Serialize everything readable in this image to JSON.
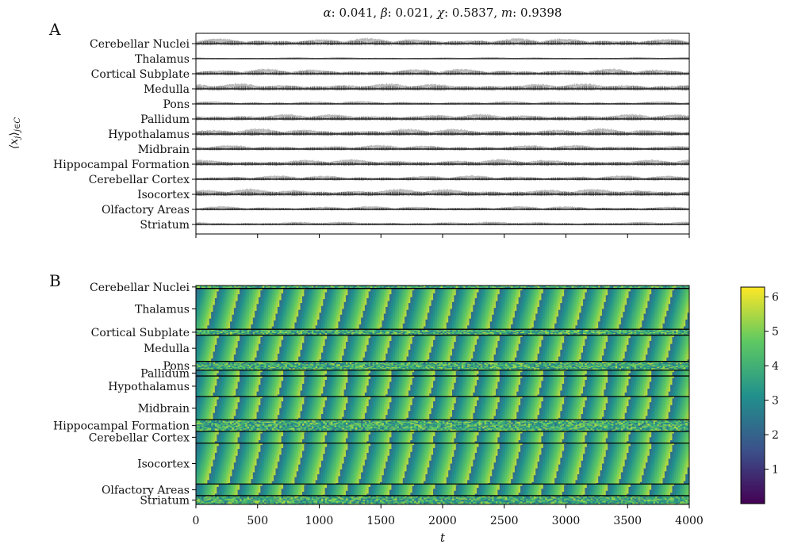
{
  "figure": {
    "title": "α: 0.041, β: 0.021, χ: 0.5837, m: 0.9398",
    "title_parts": [
      {
        "text": "α",
        "italic": true
      },
      {
        "text": ": 0.041, ",
        "italic": false
      },
      {
        "text": "β",
        "italic": true
      },
      {
        "text": ": 0.021, ",
        "italic": false
      },
      {
        "text": "χ",
        "italic": true
      },
      {
        "text": ": 0.5837, ",
        "italic": false
      },
      {
        "text": "m",
        "italic": true
      },
      {
        "text": ": 0.9398",
        "italic": false
      }
    ]
  },
  "chart_data": [
    {
      "type": "line",
      "panel_label": "A",
      "ylabel": "⟨x_j⟩_{j∈C}",
      "ylabel_parts": {
        "base": "⟨x",
        "sub1": "j",
        "close": "⟩",
        "sub2": "j∈C"
      },
      "xlim": [
        0,
        4000
      ],
      "xticks": [
        0,
        500,
        1000,
        1500,
        2000,
        2500,
        3000,
        3500,
        4000
      ],
      "xticklabels_shown": false,
      "grid": false,
      "series_color": "#222222",
      "series_alt_color": "#a8a8a8",
      "regions": [
        "Cerebellar Nuclei",
        "Thalamus",
        "Cortical Subplate",
        "Medulla",
        "Pons",
        "Pallidum",
        "Hypothalamus",
        "Midbrain",
        "Hippocampal Formation",
        "Cerebellar Cortex",
        "Isocortex",
        "Olfactory Areas",
        "Striatum"
      ],
      "series_amplitude": [
        1.0,
        0.3,
        0.9,
        1.0,
        0.5,
        0.9,
        1.0,
        0.75,
        0.9,
        0.7,
        1.0,
        0.6,
        0.5
      ]
    },
    {
      "type": "heatmap",
      "panel_label": "B",
      "xlabel": "t",
      "xlim": [
        0,
        4000
      ],
      "xticks": [
        0,
        500,
        1000,
        1500,
        2000,
        2500,
        3000,
        3500,
        4000
      ],
      "xticklabels": [
        "0",
        "500",
        "1000",
        "1500",
        "2000",
        "2500",
        "3000",
        "3500",
        "4000"
      ],
      "colormap": "viridis",
      "colormap_stops": [
        "#440154",
        "#3b528b",
        "#21918c",
        "#5ec962",
        "#fde725"
      ],
      "colorbar": {
        "range": [
          0,
          6.28
        ],
        "ticks": [
          1,
          2,
          3,
          4,
          5,
          6
        ],
        "ticklabels": [
          "1",
          "2",
          "3",
          "4",
          "5",
          "6"
        ]
      },
      "row_groups": [
        {
          "label": "Cerebellar Nuclei",
          "rel_size": 1
        },
        {
          "label": "Thalamus",
          "rel_size": 14
        },
        {
          "label": "Cortical Subplate",
          "rel_size": 2
        },
        {
          "label": "Medulla",
          "rel_size": 9
        },
        {
          "label": "Pons",
          "rel_size": 3
        },
        {
          "label": "Pallidum",
          "rel_size": 2
        },
        {
          "label": "Hypothalamus",
          "rel_size": 7
        },
        {
          "label": "Midbrain",
          "rel_size": 8
        },
        {
          "label": "Hippocampal Formation",
          "rel_size": 4
        },
        {
          "label": "Cerebellar Cortex",
          "rel_size": 4
        },
        {
          "label": "Isocortex",
          "rel_size": 14
        },
        {
          "label": "Olfactory Areas",
          "rel_size": 4
        },
        {
          "label": "Striatum",
          "rel_size": 3
        }
      ],
      "grid": false
    }
  ]
}
